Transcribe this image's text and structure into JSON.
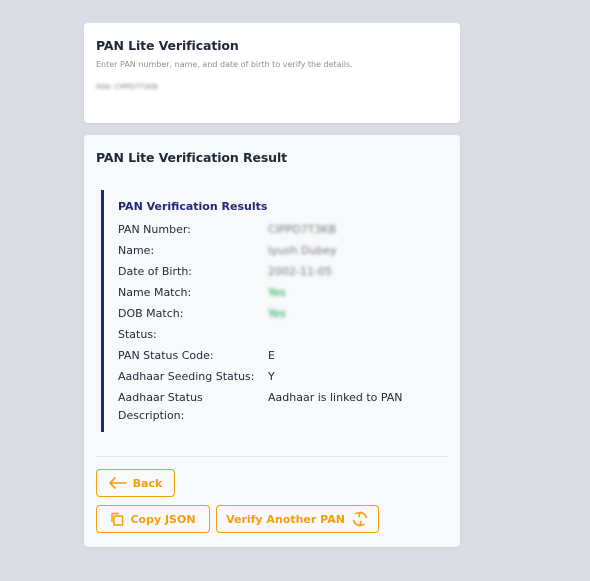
{
  "top_card": {
    "title": "PAN Lite Verification",
    "subtitle": "Enter PAN number, name, and date of birth to verify the details.",
    "blurred_text": "PAN: CIPPD7T3KB"
  },
  "result_card": {
    "title": "PAN Lite Verification Result",
    "section_heading": "PAN Verification Results",
    "rows": [
      {
        "label": "PAN Number:",
        "value": "CIPPD7T3KB"
      },
      {
        "label": "Name:",
        "value": "Iyush Dubey"
      },
      {
        "label": "Date of Birth:",
        "value": "2002-11-05"
      },
      {
        "label": "Name Match:",
        "value": "Yes"
      },
      {
        "label": "DOB Match:",
        "value": "Yes"
      },
      {
        "label": "Status:",
        "value": ""
      },
      {
        "label": "PAN Status Code:",
        "value": "E"
      },
      {
        "label": "Aadhaar Seeding Status:",
        "value": "Y"
      },
      {
        "label": "Aadhaar Status Description:",
        "value": "Aadhaar is linked to PAN"
      }
    ]
  },
  "buttons": {
    "back": "Back",
    "copy_json": "Copy JSON",
    "verify_another": "Verify Another PAN"
  },
  "colors": {
    "accent": "#f59e0b",
    "heading_blue": "#1e2a78",
    "match_green": "#16a34a",
    "background": "#d9dde3"
  },
  "icons": {
    "back": "arrow-left-icon",
    "copy": "copy-icon",
    "verify": "refresh-icon"
  }
}
